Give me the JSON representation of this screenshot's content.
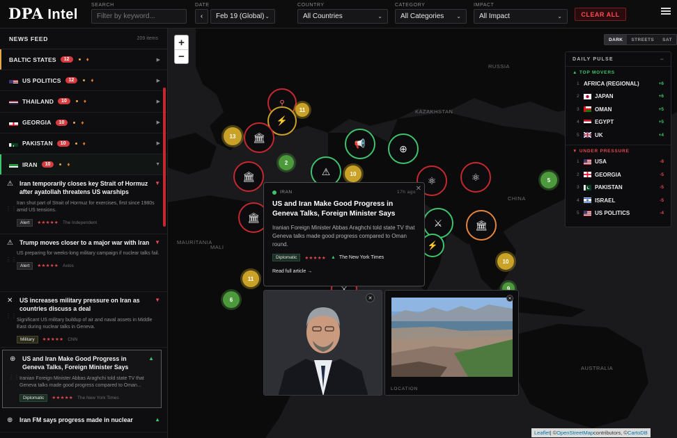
{
  "app": {
    "logo_main": "DPA",
    "logo_sub": " Intel"
  },
  "filters": {
    "search_label": "SEARCH",
    "search_placeholder": "Filter by keyword...",
    "date_label": "DATE",
    "date_value": "Feb 19 (Global)",
    "country_label": "COUNTRY",
    "country_value": "All Countries",
    "category_label": "CATEGORY",
    "category_value": "All Categories",
    "impact_label": "IMPACT",
    "impact_value": "All Impact",
    "clear_label": "CLEAR ALL"
  },
  "sidebar": {
    "title": "NEWS FEED",
    "count": "209 items",
    "countries": [
      {
        "name": "BALTIC STATES",
        "count": "12",
        "accent": "#e8a64a"
      },
      {
        "name": "US POLITICS",
        "count": "12",
        "accent": ""
      },
      {
        "name": "THAILAND",
        "count": "10",
        "accent": ""
      },
      {
        "name": "GEORGIA",
        "count": "10",
        "accent": ""
      },
      {
        "name": "PAKISTAN",
        "count": "10",
        "accent": ""
      },
      {
        "name": "IRAN",
        "count": "10",
        "accent": "#3ec46d"
      }
    ],
    "articles": [
      {
        "title": "Iran temporarily closes key Strait of Hormuz after ayatollah threatens US warships",
        "desc": "Iran shut part of Strait of Hormuz for exercises, first since 1980s amid US tensions.",
        "tag": "Alert",
        "stars": "★★★★★",
        "source": "The Independent",
        "dir": "▼"
      },
      {
        "title": "Trump moves closer to a major war with Iran",
        "desc": "US preparing for weeks-long military campaign if nuclear talks fail.",
        "tag": "Alert",
        "stars": "★★★★★",
        "source": "Axios",
        "dir": "▼"
      },
      {
        "title": "US increases military pressure on Iran as countries discuss a deal",
        "desc": "Significant US military buildup of air and naval assets in Middle East during nuclear talks in Geneva.",
        "tag": "Military",
        "stars": "★★★★★",
        "source": "CNN",
        "dir": "▼"
      },
      {
        "title": "US and Iran Make Good Progress in Geneva Talks, Foreign Minister Says",
        "desc": "Iranian Foreign Minister Abbas Araghchi told state TV that Geneva talks made good progress compared to Oman...",
        "tag": "Diplomatic",
        "stars": "★★★★★",
        "source": "The New York Times",
        "dir": "▲"
      },
      {
        "title": "Iran FM says progress made in nuclear",
        "dir": "▲"
      }
    ]
  },
  "map": {
    "labels": {
      "russia": "RUSSIA",
      "kazakhstan": "KAZAKHSTAN",
      "china": "CHINA",
      "mauritania": "MAURITANIA",
      "mali": "MALI",
      "australia": "AUSTRALIA"
    },
    "styles": [
      "DARK",
      "STREETS",
      "SAT"
    ],
    "zoom_in": "+",
    "zoom_out": "−",
    "attribution": {
      "leaflet": "Leaflet",
      "sep1": " | © ",
      "osm": "OpenStreetMap",
      "mid": " contributors, © ",
      "carto": "CartoDB"
    },
    "clusters": [
      "13",
      "11",
      "2",
      "10",
      "5",
      "10",
      "11",
      "6",
      "9"
    ]
  },
  "pulse": {
    "title": "DAILY PULSE",
    "minimize": "−",
    "top_label": "▲ TOP MOVERS",
    "top": [
      {
        "rank": "1",
        "name": "AFRICA (REGIONAL)",
        "change": "+6"
      },
      {
        "rank": "2",
        "name": "JAPAN",
        "change": "+6"
      },
      {
        "rank": "3",
        "name": "OMAN",
        "change": "+5"
      },
      {
        "rank": "4",
        "name": "EGYPT",
        "change": "+5"
      },
      {
        "rank": "5",
        "name": "UK",
        "change": "+4"
      }
    ],
    "down_label": "▼ UNDER PRESSURE",
    "down": [
      {
        "rank": "1",
        "name": "USA",
        "change": "-8"
      },
      {
        "rank": "2",
        "name": "GEORGIA",
        "change": "-5"
      },
      {
        "rank": "3",
        "name": "PAKISTAN",
        "change": "-5"
      },
      {
        "rank": "4",
        "name": "ISRAEL",
        "change": "-5"
      },
      {
        "rank": "5",
        "name": "US POLITICS",
        "change": "-4"
      }
    ]
  },
  "popup": {
    "country": "IRAN",
    "time": "17h ago",
    "title": "US and Iran Make Good Progress in Geneva Talks, Foreign Minister Says",
    "desc": "Iranian Foreign Minister Abbas Araghchi told state TV that Geneva talks made good progress compared to Oman round.",
    "tag": "Diplomatic",
    "stars": "★★★★★",
    "direction": "▲",
    "source": "The New York Times",
    "read": "Read full article →",
    "location_label": "LOCATION"
  },
  "colors": {
    "accent_red": "#d63b40",
    "accent_green": "#3ec46d",
    "background": "#0b0b0c"
  }
}
